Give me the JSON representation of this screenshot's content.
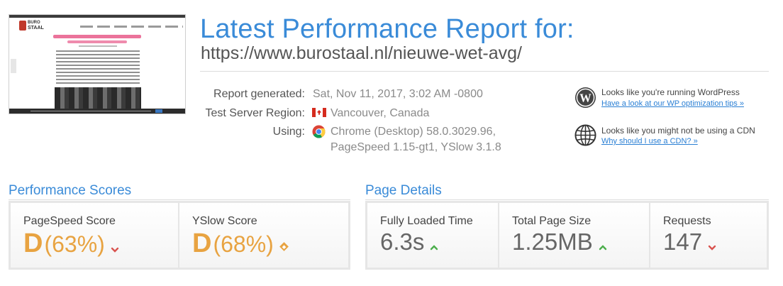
{
  "report": {
    "heading": "Latest Performance Report for:",
    "url": "https://www.burostaal.nl/nieuwe-wet-avg/"
  },
  "thumbnail": {
    "logo_line1": "BURO",
    "logo_line2": "STAAL"
  },
  "meta": {
    "generated_label": "Report generated:",
    "generated_value": "Sat, Nov 11, 2017, 3:02 AM -0800",
    "region_label": "Test Server Region:",
    "region_value": "Vancouver, Canada",
    "region_icon": "canada-flag-icon",
    "using_label": "Using:",
    "using_line1": "Chrome (Desktop) 58.0.3029.96,",
    "using_line2": "PageSpeed 1.15-gt1, YSlow 3.1.8",
    "using_icon": "chrome-icon"
  },
  "hints": [
    {
      "icon": "wordpress-icon",
      "text": "Looks like you're running WordPress",
      "link": "Have a look at our WP optimization tips »"
    },
    {
      "icon": "globe-icon",
      "text": "Looks like you might not be using a CDN",
      "link": "Why should I use a CDN? »"
    }
  ],
  "performance_scores": {
    "title": "Performance Scores",
    "pagespeed": {
      "label": "PageSpeed Score",
      "grade": "D",
      "percent": "(63%)",
      "trend": "down"
    },
    "yslow": {
      "label": "YSlow Score",
      "grade": "D",
      "percent": "(68%)",
      "trend": "neutral"
    }
  },
  "page_details": {
    "title": "Page Details",
    "loaded_time": {
      "label": "Fully Loaded Time",
      "value": "6.3s",
      "trend": "up"
    },
    "page_size": {
      "label": "Total Page Size",
      "value": "1.25MB",
      "trend": "up"
    },
    "requests": {
      "label": "Requests",
      "value": "147",
      "trend": "down"
    }
  },
  "colors": {
    "accent_blue": "#3a8bd8",
    "grade_orange": "#e8a341",
    "trend_green": "#4cae4c",
    "trend_red": "#d9534f"
  }
}
